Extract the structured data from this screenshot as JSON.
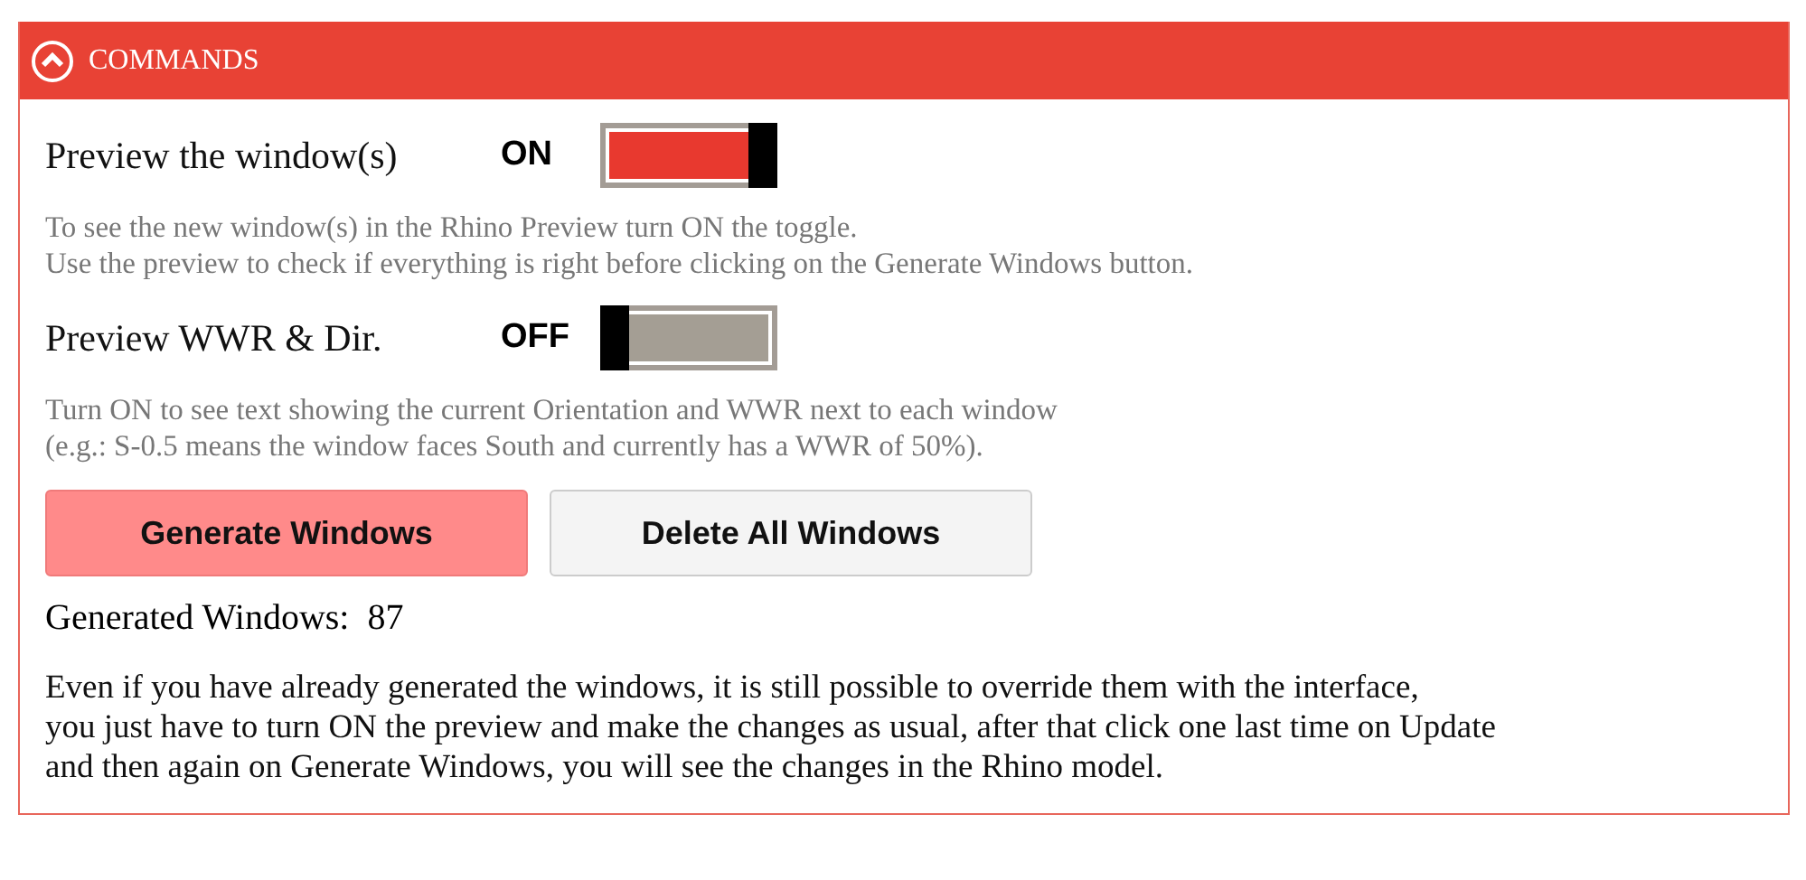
{
  "section": {
    "title": "COMMANDS",
    "expanded": true
  },
  "toggles": [
    {
      "label": "Preview the window(s)",
      "state_text": "ON",
      "on": true,
      "help": [
        "To see the new window(s) in the Rhino Preview turn ON the toggle.",
        "Use the preview to check if everything is right before clicking on the Generate Windows button."
      ]
    },
    {
      "label": "Preview WWR & Dir.",
      "state_text": "OFF",
      "on": false,
      "help": [
        "Turn ON to see text showing the current Orientation and WWR next to each window",
        "(e.g.: S-0.5 means the window faces South and currently has a WWR of 50%)."
      ]
    }
  ],
  "buttons": [
    {
      "label": "Generate Windows",
      "kind": "primary"
    },
    {
      "label": "Delete All Windows",
      "kind": "secondary"
    }
  ],
  "generated": {
    "label": "Generated Windows:",
    "value": "87"
  },
  "note": [
    "Even if you have already generated the windows, it is still possible to override them with the interface,",
    "you just have to turn ON the preview and make the changes as usual, after that click one last time on Update",
    "and then again on Generate Windows, you will see the changes in the Rhino model."
  ]
}
